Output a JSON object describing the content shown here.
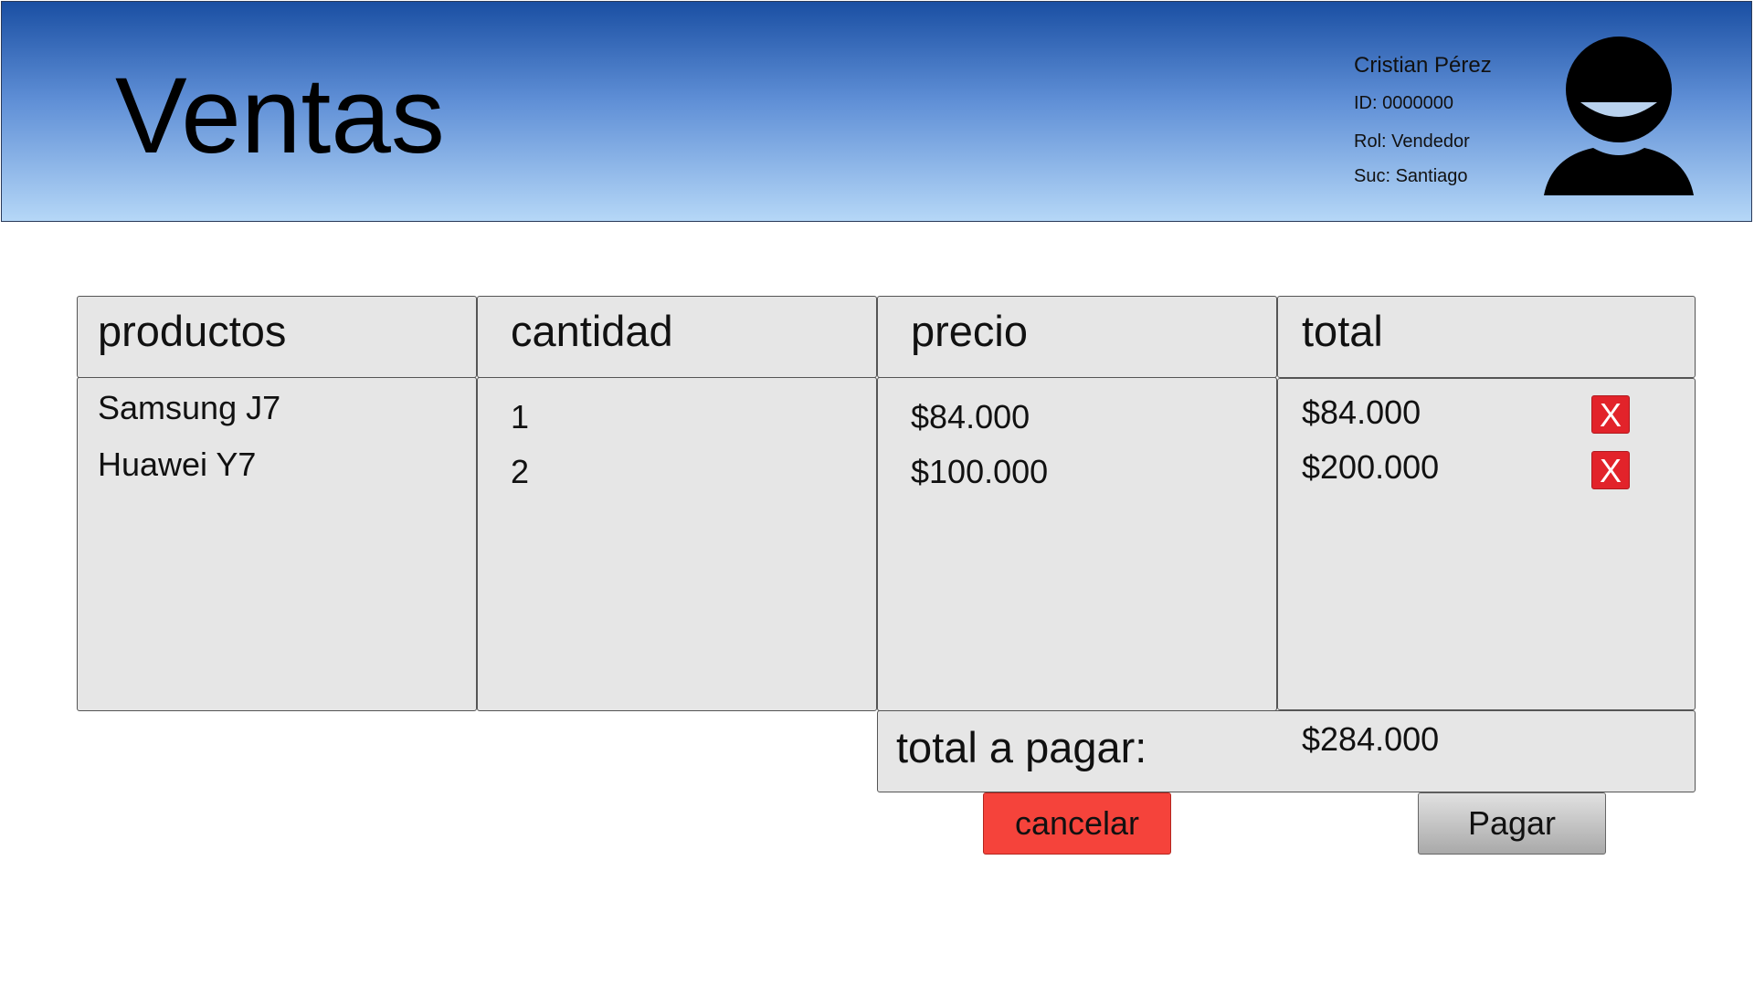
{
  "header": {
    "title": "Ventas",
    "user": {
      "name": "Cristian Pérez",
      "id": "ID: 0000000",
      "role": "Rol: Vendedor",
      "branch": "Suc: Santiago"
    },
    "avatar_icon": "user-avatar-icon",
    "gradient_colors": [
      "#1a4fa3",
      "#5f8fd6",
      "#b5d7f7"
    ]
  },
  "table": {
    "columns": [
      "productos",
      "cantidad",
      "precio",
      "total"
    ],
    "rows": [
      {
        "product": "Samsung J7",
        "quantity": "1",
        "price": "$84.000",
        "total": "$84.000",
        "remove_label": "X"
      },
      {
        "product": "Huawei Y7",
        "quantity": "2",
        "price": "$100.000",
        "total": "$200.000",
        "remove_label": "X"
      }
    ]
  },
  "summary": {
    "label": "total a pagar:",
    "value": "$284.000"
  },
  "actions": {
    "cancel_label": "cancelar",
    "pay_label": "Pagar",
    "cancel_color": "#f5433b",
    "remove_color": "#e2232a"
  }
}
